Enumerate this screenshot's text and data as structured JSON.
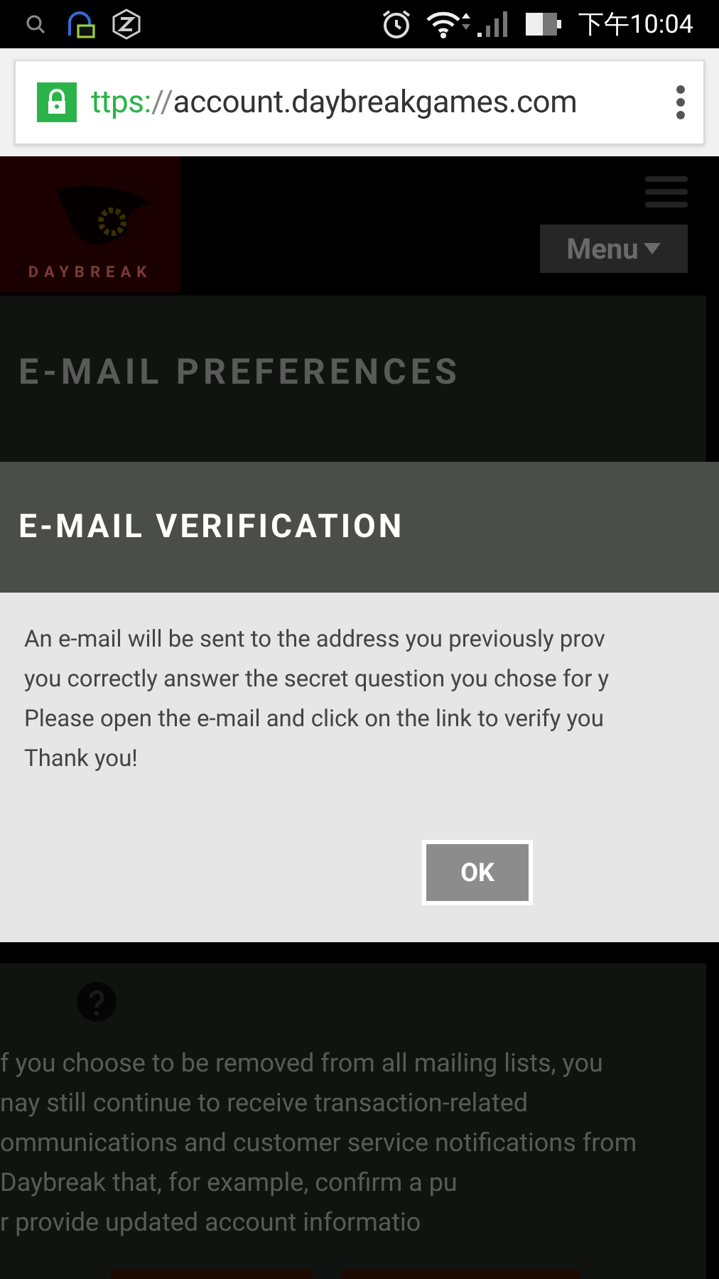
{
  "status_bar": {
    "time": "下午10:04"
  },
  "browser": {
    "url_scheme": "ttps:",
    "url_sep": "//",
    "url_host": "account.daybreakgames.com",
    "secure": true
  },
  "site_header": {
    "logo_text": "DAYBREAK",
    "menu_button": "Menu"
  },
  "section": {
    "title": "E-MAIL PREFERENCES"
  },
  "dialog": {
    "title": "E-MAIL VERIFICATION",
    "lines": [
      "An e-mail will be sent to the address you previously prov",
      "you correctly answer the secret question you chose for y",
      "Please open the e-mail and click on the link to verify you",
      "Thank you!"
    ],
    "ok_button": "OK"
  },
  "notice": {
    "lines": [
      "f you choose to be removed from all mailing lists, you",
      "nay still continue to receive transaction-related",
      "ommunications and customer service notifications from",
      "Daybreak that, for example, confirm a pu",
      "r provide updated account informatio"
    ]
  }
}
